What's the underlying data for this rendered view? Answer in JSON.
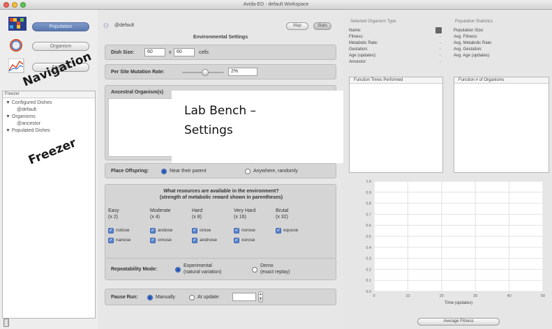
{
  "window": {
    "title": "Avida-ED · default Workspace"
  },
  "navigation": {
    "buttons": [
      {
        "label": "Population",
        "selected": true
      },
      {
        "label": "Organism",
        "selected": false
      },
      {
        "label": "Analysis",
        "selected": false
      }
    ]
  },
  "freezer": {
    "header": "Freezer",
    "tree": [
      {
        "label": "▼ Configured Dishes",
        "level": 0
      },
      {
        "label": "@default",
        "level": 1
      },
      {
        "label": "▼ Organisms",
        "level": 0
      },
      {
        "label": "@ancestor",
        "level": 1
      },
      {
        "label": "▼ Populated Dishes",
        "level": 0
      }
    ]
  },
  "bench": {
    "dish_name": "@default",
    "map_label": "Map",
    "stats_label": "Stats",
    "env_title": "Environmental Settings",
    "dish_size_label": "Dish Size:",
    "dish_w": "60",
    "dish_x": "x",
    "dish_h": "60",
    "dish_units": "cells",
    "mutation_label": "Per Site Mutation Rate:",
    "mutation_value": "2%",
    "mutation_fraction": 0.55,
    "ancestral_label": "Ancestral Organism(s)",
    "offspring_label": "Place Offspring:",
    "offspring_opt1": "Near their parent",
    "offspring_opt2": "Anywhere, randomly",
    "resources_title_1": "What resources are available in the environment?",
    "resources_title_2": "(strength of metabolic reward shown in parentheses)",
    "resource_groups": [
      {
        "name": "Easy",
        "reward": "(x 2)",
        "items": [
          "notose",
          "nanose"
        ]
      },
      {
        "name": "Moderate",
        "reward": "(x 4)",
        "items": [
          "andose",
          "ornose"
        ]
      },
      {
        "name": "Hard",
        "reward": "(x 8)",
        "items": [
          "orose",
          "andnose"
        ]
      },
      {
        "name": "Very Hard",
        "reward": "(x 16)",
        "items": [
          "norose",
          "xorose"
        ]
      },
      {
        "name": "Brutal",
        "reward": "(x 32)",
        "items": [
          "equose"
        ]
      }
    ],
    "repeat_label": "Repeatability Mode:",
    "repeat_opt1_a": "Experimental",
    "repeat_opt1_b": "(natural variation)",
    "repeat_opt2_a": "Demo",
    "repeat_opt2_b": "(exact replay)",
    "pause_label": "Pause Run:",
    "pause_opt1": "Manually",
    "pause_opt2": "At update:",
    "pause_value": ""
  },
  "overlays": {
    "navigation": "Navigation",
    "freezer": "Freezer",
    "lab_line1": "Lab Bench –",
    "lab_line2": "Settings"
  },
  "selected_organism": {
    "title": "Selected Organism Type",
    "props": [
      "Name:",
      "Fitness:",
      "Metabolic Rate:",
      "Gestation:",
      "Age (updates):",
      "Ancestor:"
    ],
    "vals": [
      "-",
      "-",
      "-",
      "-",
      "-",
      "-"
    ],
    "table_head": "Function   Times Performed"
  },
  "population_stats": {
    "title": "Population Statistics",
    "props": [
      "Population Size:",
      "Avg. Fitness:",
      "Avg. Metabolic Rate:",
      "Avg. Gestation:",
      "Avg. Age (updates):"
    ],
    "table_head": "Function   # of Organisms"
  },
  "chart_data": {
    "type": "line",
    "title": "",
    "xlabel": "Time (updates)",
    "ylabel": "",
    "xlim": [
      0,
      50
    ],
    "ylim": [
      0,
      1.0
    ],
    "x_ticks": [
      "0",
      "10",
      "20",
      "30",
      "40",
      "50"
    ],
    "y_ticks": [
      "0.0",
      "0.1",
      "0.2",
      "0.3",
      "0.4",
      "0.5",
      "0.6",
      "0.7",
      "0.8",
      "0.9",
      "1.0"
    ],
    "grid": true,
    "series": []
  },
  "graph_select": {
    "value": "Average Fitness"
  }
}
